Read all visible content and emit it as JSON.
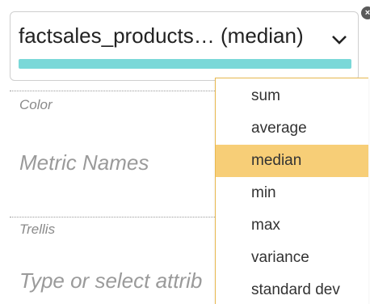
{
  "metric_chip": {
    "label": "factsales_products… (median)",
    "bar_color": "#7ad8d8",
    "chevron_icon": "chevron-down-icon",
    "remove_icon": "close-icon"
  },
  "sections": {
    "color": {
      "label": "Color",
      "value": "Metric Names"
    },
    "trellis": {
      "label": "Trellis",
      "placeholder": "Type or select attrib"
    }
  },
  "aggregation_menu": {
    "items": [
      "sum",
      "average",
      "median",
      "min",
      "max",
      "variance",
      "standard dev"
    ],
    "selected": "median",
    "border_color": "#e8b84f",
    "highlight_color": "#f7ce77"
  }
}
